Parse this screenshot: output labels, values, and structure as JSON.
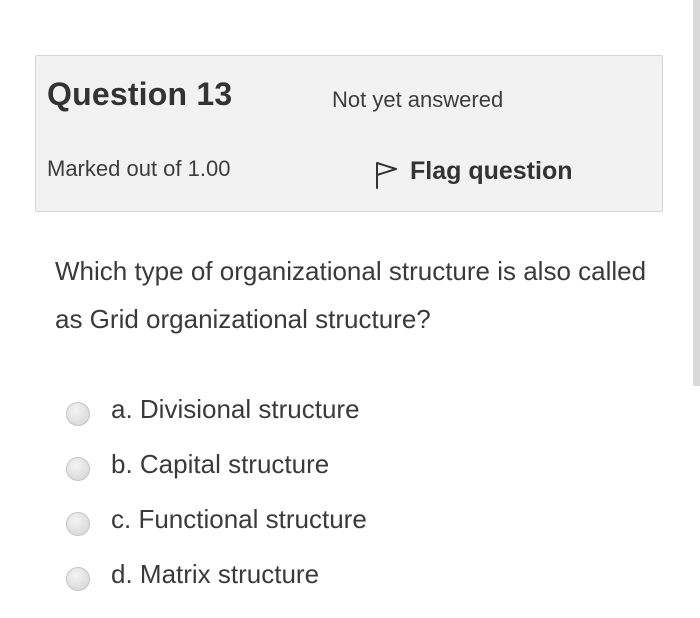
{
  "info": {
    "question_label": "Question 13",
    "status": "Not yet answered",
    "marks": "Marked out of 1.00",
    "flag_label": "Flag question"
  },
  "question": {
    "text": "Which type of organizational structure is also called as Grid organizational structure?"
  },
  "answers": [
    {
      "label": "a. Divisional structure",
      "selected": false
    },
    {
      "label": "b. Capital structure",
      "selected": false
    },
    {
      "label": "c. Functional structure",
      "selected": false
    },
    {
      "label": "d. Matrix structure",
      "selected": false
    }
  ],
  "icons": {
    "flag": "flag-outline-icon"
  },
  "colors": {
    "info_background": "#f2f2f2",
    "info_border": "#d6d6d6",
    "text": "#3a3a3a",
    "radio": "#dcdcdc"
  }
}
